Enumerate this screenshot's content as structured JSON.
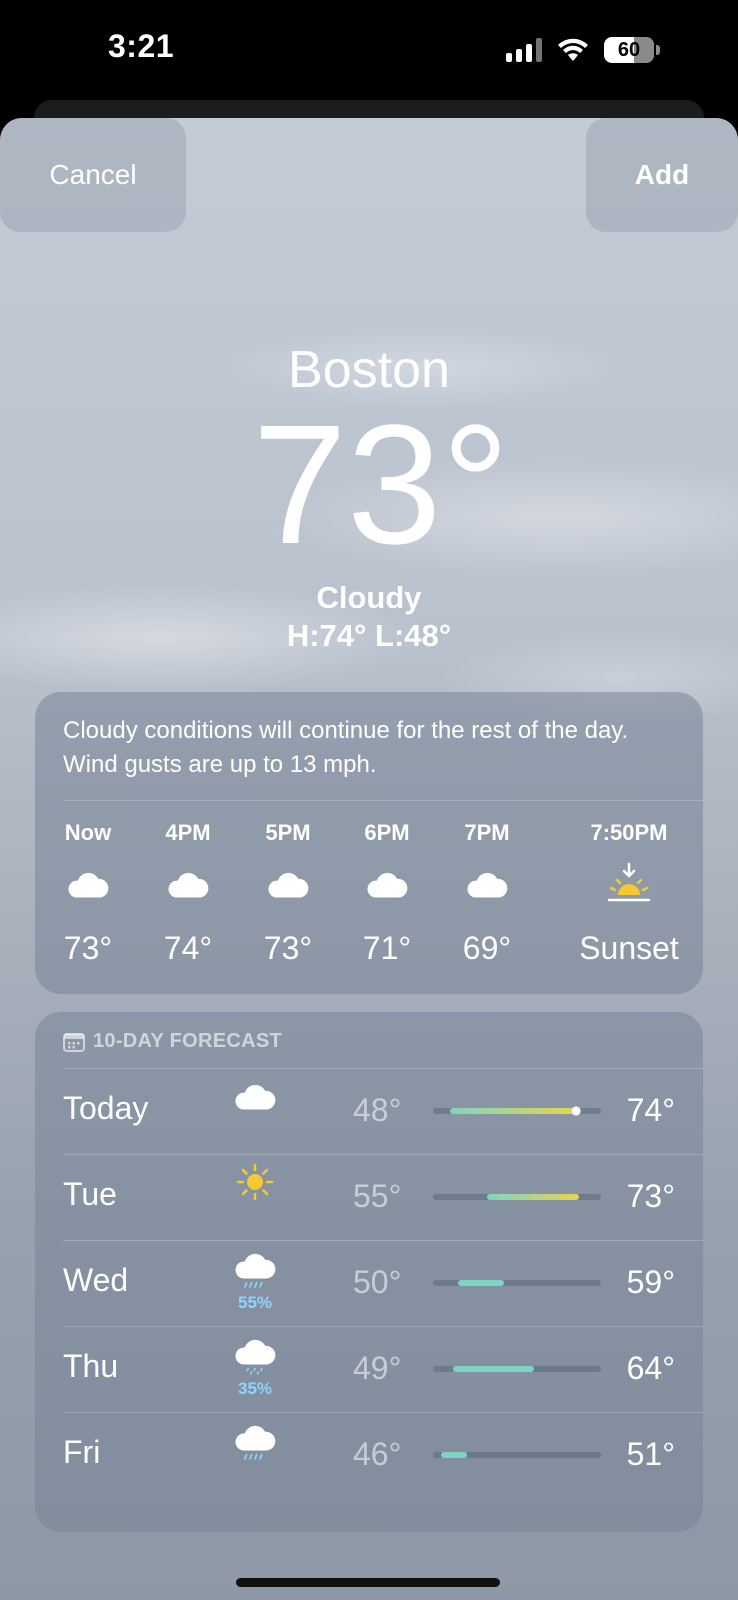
{
  "status_bar": {
    "time": "3:21",
    "battery": "60"
  },
  "nav": {
    "cancel": "Cancel",
    "add": "Add"
  },
  "location": {
    "city": "Boston",
    "temperature": "73°",
    "condition": "Cloudy",
    "hilo": "H:74°  L:48°"
  },
  "hourly": {
    "summary": "Cloudy conditions will continue for the rest of the day. Wind gusts are up to 13 mph.",
    "items": [
      {
        "label": "Now",
        "icon": "cloud-icon",
        "temp": "73°"
      },
      {
        "label": "4PM",
        "icon": "cloud-icon",
        "temp": "74°"
      },
      {
        "label": "5PM",
        "icon": "cloud-icon",
        "temp": "73°"
      },
      {
        "label": "6PM",
        "icon": "cloud-icon",
        "temp": "71°"
      },
      {
        "label": "7PM",
        "icon": "cloud-icon",
        "temp": "69°"
      },
      {
        "label": "7:50PM",
        "icon": "sunset-icon",
        "temp": "Sunset"
      }
    ]
  },
  "forecast": {
    "header": "10-DAY FORECAST",
    "days": [
      {
        "day": "Today",
        "icon": "cloud-icon",
        "precip": "",
        "low": "48°",
        "high": "74°",
        "range_start": 0.1,
        "range_end": 0.85,
        "current": 0.85
      },
      {
        "day": "Tue",
        "icon": "sun-icon",
        "precip": "",
        "low": "55°",
        "high": "73°",
        "range_start": 0.32,
        "range_end": 0.87
      },
      {
        "day": "Wed",
        "icon": "rain-cloud-icon",
        "precip": "55%",
        "low": "50°",
        "high": "59°",
        "range_start": 0.15,
        "range_end": 0.42
      },
      {
        "day": "Thu",
        "icon": "drizzle-cloud-icon",
        "precip": "35%",
        "low": "49°",
        "high": "64°",
        "range_start": 0.12,
        "range_end": 0.6
      },
      {
        "day": "Fri",
        "icon": "rain-cloud-icon",
        "precip": "",
        "low": "46°",
        "high": "51°",
        "range_start": 0.05,
        "range_end": 0.2
      }
    ]
  },
  "colors": {
    "cool": "#7fd4c1",
    "warm": "#e8d44d",
    "precip": "#8fd3ff"
  }
}
